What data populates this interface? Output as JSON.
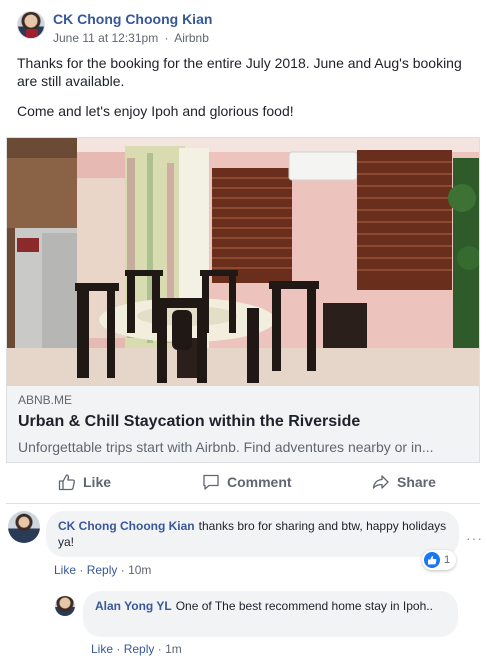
{
  "post": {
    "author": "CK Chong Choong Kian",
    "date": "June 11 at 12:31pm",
    "separator": "·",
    "via": "Airbnb",
    "paragraphs": [
      "Thanks for the booking for the entire July 2018. June and Aug's booking are still available.",
      "Come and let's enjoy Ipoh and glorious food!"
    ]
  },
  "link_card": {
    "domain": "ABNB.ME",
    "title": "Urban & Chill Staycation within the Riverside",
    "description": "Unforgettable trips start with Airbnb. Find adventures nearby or in...",
    "image_desc": "dining-room-photo"
  },
  "actions": {
    "like": "Like",
    "comment": "Comment",
    "share": "Share"
  },
  "comments": [
    {
      "author": "CK Chong Choong Kian",
      "text": "thanks bro for sharing and btw, happy holidays ya!",
      "like": "Like",
      "reply": "Reply",
      "time": "10m",
      "reaction_count": "1"
    },
    {
      "author": "Alan Yong YL",
      "text": "One of The best recommend home stay in Ipoh..",
      "like": "Like",
      "reply": "Reply",
      "time": "1m"
    }
  ],
  "colors": {
    "link_blue": "#365899",
    "secondary_text": "#606770",
    "like_blue": "#1877f2"
  }
}
